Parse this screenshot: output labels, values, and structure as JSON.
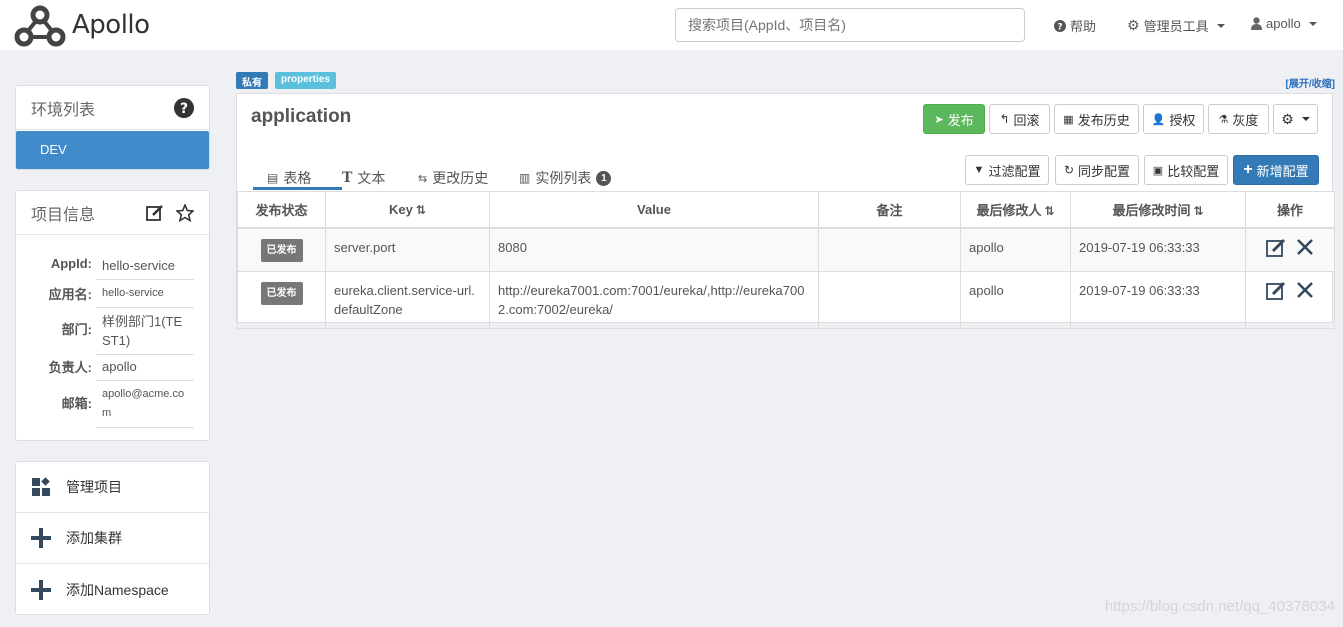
{
  "header": {
    "brand": "Apollo",
    "search_placeholder": "搜索项目(AppId、项目名)",
    "help": "帮助",
    "admin_tools": "管理员工具",
    "user": "apollo"
  },
  "env_panel": {
    "title": "环境列表",
    "envs": [
      "DEV"
    ]
  },
  "project_info": {
    "title": "项目信息",
    "fields": [
      {
        "label": "AppId:",
        "value": "hello-service"
      },
      {
        "label": "应用名:",
        "value": "hello-service"
      },
      {
        "label": "部门:",
        "value": "样例部门1(TEST1)"
      },
      {
        "label": "负责人:",
        "value": "apollo"
      },
      {
        "label": "邮箱:",
        "value": "apollo@acme.com"
      }
    ]
  },
  "actions": [
    "管理项目",
    "添加集群",
    "添加Namespace"
  ],
  "namespace": {
    "tags": [
      "私有",
      "properties"
    ],
    "toggle": "[展开/收缩]",
    "name": "application",
    "buttons": {
      "publish": "发布",
      "rollback": "回滚",
      "history": "发布历史",
      "grant": "授权",
      "gray": "灰度"
    },
    "tabs": [
      "表格",
      "文本",
      "更改历史",
      "实例列表"
    ],
    "instance_count": "1",
    "tools": {
      "filter": "过滤配置",
      "sync": "同步配置",
      "compare": "比较配置",
      "add": "新增配置"
    }
  },
  "table": {
    "columns": [
      "发布状态",
      "Key",
      "Value",
      "备注",
      "最后修改人",
      "最后修改时间",
      "操作"
    ],
    "rows": [
      {
        "status": "已发布",
        "key": "server.port",
        "value": "8080",
        "comment": "",
        "modifier": "apollo",
        "time": "2019-07-19 06:33:33"
      },
      {
        "status": "已发布",
        "key": "eureka.client.service-url.defaultZone",
        "value": "http://eureka7001.com:7001/eureka/,http://eureka7002.com:7002/eureka/",
        "comment": "",
        "modifier": "apollo",
        "time": "2019-07-19 06:33:33"
      }
    ]
  },
  "watermark": "https://blog.csdn.net/qq_40378034",
  "colors": {
    "primary": "#337ab7",
    "success": "#5cb85c",
    "env_active": "#428bca",
    "tag_private": "#337ab7",
    "tag_properties": "#5bc0de"
  }
}
